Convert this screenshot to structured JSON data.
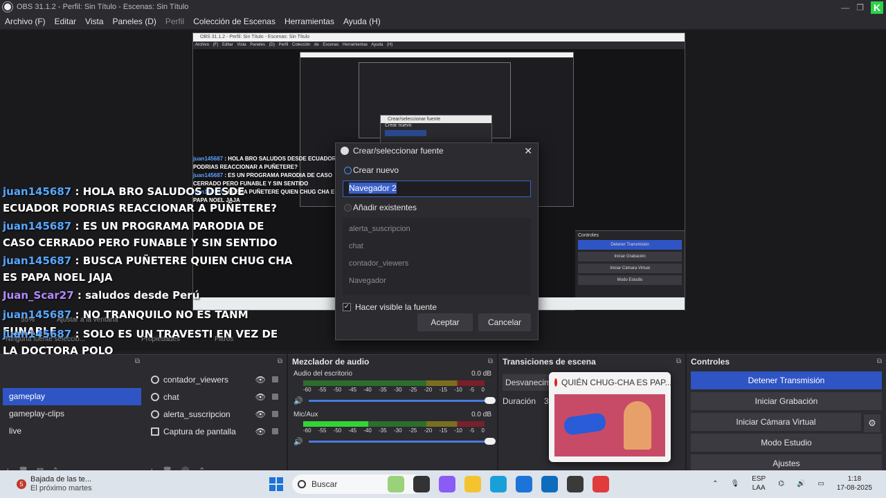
{
  "window": {
    "title": "OBS 31.1.2 - Perfil: Sin Título - Escenas: Sin Título"
  },
  "menu": [
    "Archivo (F)",
    "Editar",
    "Vista",
    "Paneles (D)",
    "Perfil",
    "Colección de Escenas",
    "Herramientas",
    "Ayuda (H)"
  ],
  "chat": [
    {
      "user": "juan145687",
      "msg": " : HOLA BRO SALUDOS DESDE ECUADOR PODRIAS REACCIONAR A PUÑETERE?"
    },
    {
      "user": "juan145687",
      "msg": " : ES UN PROGRAMA PARODIA DE CASO CERRADO PERO FUNABLE Y SIN SENTIDO"
    },
    {
      "user": "juan145687",
      "msg": " : BUSCA PUÑETERE QUIEN CHUG CHA ES PAPA NOEL JAJA"
    },
    {
      "user": "Juan_Scar27",
      "msg": " : saludos desde Perú"
    },
    {
      "user": "juan145687",
      "msg": " : NO TRANQUILO NO ES TANM FUNABLE"
    },
    {
      "user": "juan145687",
      "msg": " : SOLO ES UN TRAVESTI EN VEZ DE LA DOCTORA POLO"
    }
  ],
  "preview": {
    "status_left": "Ninguna fuente seleccio...",
    "zoom": "55%",
    "fit": "Ajustar a la ventana",
    "properties": "Propiedades",
    "filters": "Filtros"
  },
  "dialog": {
    "title": "Crear/seleccionar fuente",
    "create_new": "Crear nuevo",
    "name_value": "Navegador 2",
    "add_existing": "Añadir existentes",
    "existing": [
      "alerta_suscripcion",
      "chat",
      "contador_viewers",
      "Navegador"
    ],
    "visible_label": "Hacer visible la fuente",
    "accept": "Aceptar",
    "cancel": "Cancelar"
  },
  "scenes": {
    "items": [
      "gameplay",
      "gameplay-clips",
      "live"
    ],
    "selected": 0
  },
  "sources": {
    "items": [
      "contador_viewers",
      "chat",
      "alerta_suscripcion",
      "Captura de pantalla"
    ]
  },
  "mixer": {
    "title": "Mezclador de audio",
    "channels": [
      {
        "name": "Audio del escritorio",
        "db": "0.0 dB",
        "level": 0
      },
      {
        "name": "Mic/Aux",
        "db": "0.0 dB",
        "level": 0.36
      }
    ],
    "ticks": [
      "-60",
      "-55",
      "-50",
      "-45",
      "-40",
      "-35",
      "-30",
      "-25",
      "-20",
      "-15",
      "-10",
      "-5",
      "0"
    ]
  },
  "transitions": {
    "title": "Transiciones de escena",
    "type": "Desvanecimiento",
    "duration_label": "Duración",
    "duration_value": "3"
  },
  "popup": {
    "title": "QUIÉN CHUG-CHA ES PAP..."
  },
  "controls": {
    "title": "Controles",
    "buttons": [
      "Detener Transmisión",
      "Iniciar Grabación",
      "Iniciar Cámara Virtual",
      "Modo Estudio",
      "Ajustes"
    ]
  },
  "taskbar": {
    "news_title": "Bajada de las te...",
    "news_sub": "El próximo martes",
    "search": "Buscar",
    "lang1": "ESP",
    "lang2": "LAA",
    "time": "1:18",
    "date": "17-08-2025"
  },
  "colors": {
    "accent": "#2f55c5",
    "chat_user": "#57a7ff",
    "chat_user2": "#b38aff"
  }
}
